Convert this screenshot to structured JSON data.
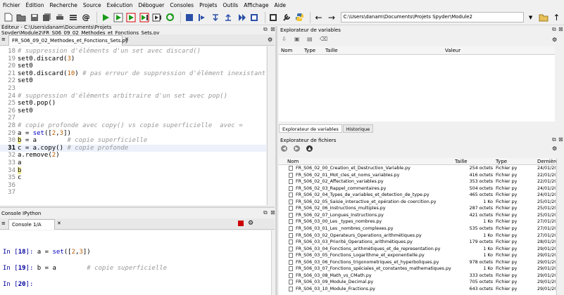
{
  "menubar": [
    "Fichier",
    "Édition",
    "Recherche",
    "Source",
    "Exécution",
    "Déboguer",
    "Consoles",
    "Projets",
    "Outils",
    "Affichage",
    "Aide"
  ],
  "toolbar": {
    "path": "C:\\Users\\danam\\Documents\\Projets Spyder\\Module2"
  },
  "editor": {
    "title": "Éditeur - C:\\Users\\danam\\Documents\\Projets Spyder\\Module2\\FR_S06_09_02_Methodes_et_Fonctions_Sets.py",
    "tab": "FR_S06_09_02_Methodes_et_Fonctions_Sets.py",
    "lines": [
      {
        "n": "18",
        "code": "# suppression d'éléments d'un set avec discard()"
      },
      {
        "n": "19",
        "code": "set0.discard(3)"
      },
      {
        "n": "20",
        "code": "set0"
      },
      {
        "n": "21",
        "code": "set0.discard(10) # pas erreur de suppression d'élément inexistant"
      },
      {
        "n": "22",
        "code": "set0"
      },
      {
        "n": "23",
        "code": ""
      },
      {
        "n": "24",
        "code": "# suppression d'éléments arbitraire d'un set avec pop()"
      },
      {
        "n": "25",
        "code": "set0.pop()"
      },
      {
        "n": "26",
        "code": "set0"
      },
      {
        "n": "27",
        "code": ""
      },
      {
        "n": "28",
        "code": "# copie profonde avec copy() vs copie superficielle  avec ="
      },
      {
        "n": "29",
        "code": "a = set([2,3])"
      },
      {
        "n": "30",
        "code": "b = a        # copie superficielle"
      },
      {
        "n": "31",
        "code": "c = a.copy() # copie profonde"
      },
      {
        "n": "32",
        "code": "a.remove(2)"
      },
      {
        "n": "33",
        "code": "a"
      },
      {
        "n": "34",
        "code": "b"
      },
      {
        "n": "35",
        "code": "c"
      },
      {
        "n": "36",
        "code": ""
      },
      {
        "n": "37",
        "code": ""
      }
    ]
  },
  "variables": {
    "title": "Explorateur de variables",
    "columns": [
      "Nom",
      "Type",
      "Taille",
      "Valeur"
    ],
    "tabs": [
      "Explorateur de variables",
      "Historique"
    ]
  },
  "files": {
    "title": "Explorateur de fichiers",
    "columns": [
      "Nom",
      "Taille",
      "Type",
      "Dernière"
    ],
    "rows": [
      {
        "name": "FR_S06_02_00_Creation_et_Destruction_Variable.py",
        "size": "254 octets",
        "type": "Fichier py",
        "date": "24/01/20"
      },
      {
        "name": "FR_S06_02_01_Mot_cles_et_noms_variables.py",
        "size": "416 octets",
        "type": "Fichier py",
        "date": "22/01/20"
      },
      {
        "name": "FR_S06_02_02_Affectation_variables.py",
        "size": "353 octets",
        "type": "Fichier py",
        "date": "22/01/20"
      },
      {
        "name": "FR_S06_02_03_Rappel_commentaires.py",
        "size": "504 octets",
        "type": "Fichier py",
        "date": "24/01/20"
      },
      {
        "name": "FR_S06_02_04_Types_de_variables_et_detection_de_type.py",
        "size": "465 octets",
        "type": "Fichier py",
        "date": "24/01/20"
      },
      {
        "name": "FR_S06_02_05_Saisie_interactive_et_opération de coercition.py",
        "size": "1 Ko",
        "type": "Fichier py",
        "date": "25/01/20"
      },
      {
        "name": "FR_S06_02_06_Instructions_multiples.py",
        "size": "287 octets",
        "type": "Fichier py",
        "date": "25/01/20"
      },
      {
        "name": "FR_S06_02_07_Longues_Instructions.py",
        "size": "421 octets",
        "type": "Fichier py",
        "date": "25/01/20"
      },
      {
        "name": "FR_S06_03_00_Les _types_nombres.py",
        "size": "1 Ko",
        "type": "Fichier py",
        "date": "27/01/20"
      },
      {
        "name": "FR_S06_03_01_Les _nombres_complexes.py",
        "size": "535 octets",
        "type": "Fichier py",
        "date": "27/01/20"
      },
      {
        "name": "FR_S06_03_02_Operateurs_Operations_arithmétiques.py",
        "size": "1 Ko",
        "type": "Fichier py",
        "date": "27/01/20"
      },
      {
        "name": "FR_S06_03_03_Priorité_Operations_arithmétiques.py",
        "size": "179 octets",
        "type": "Fichier py",
        "date": "28/01/20"
      },
      {
        "name": "FR_S06_03_04_Fonctions_arithmétiques_et_de_representation.py",
        "size": "1 Ko",
        "type": "Fichier py",
        "date": "29/01/20"
      },
      {
        "name": "FR_S06_03_05_Fonctions_Logarithme_et_exponentielle.py",
        "size": "1 Ko",
        "type": "Fichier py",
        "date": "29/01/20"
      },
      {
        "name": "FR_S06_03_06_Fonctions_trigonometriques_et_hyperboliques.py",
        "size": "978 octets",
        "type": "Fichier py",
        "date": "29/01/20"
      },
      {
        "name": "FR_S06_03_07_Fonctions_spéciales_et_constantes_mathematiques.py",
        "size": "1 Ko",
        "type": "Fichier py",
        "date": "29/01/20"
      },
      {
        "name": "FR_S06_03_08_Math_vs_CMath.py",
        "size": "333 octets",
        "type": "Fichier py",
        "date": "29/01/20"
      },
      {
        "name": "FR_S06_03_09_Module_Decimal.py",
        "size": "705 octets",
        "type": "Fichier py",
        "date": "29/01/20"
      },
      {
        "name": "FR_S06_03_10_Module_Fractions.py",
        "size": "643 octets",
        "type": "Fichier py",
        "date": "29/01/20"
      }
    ]
  },
  "console": {
    "title": "Console IPython",
    "tab": "Console 1/A",
    "lines": [
      {
        "prompt": "In [",
        "num": "18",
        "close": "]: ",
        "code": "a = set([2,3])"
      },
      {
        "prompt": "In [",
        "num": "19",
        "close": "]: ",
        "code": "b = a        # copie superficielle"
      },
      {
        "prompt": "In [",
        "num": "20",
        "close": "]: ",
        "code": ""
      }
    ]
  },
  "colors": {
    "accent": "#0000c0",
    "current_line": "#ecf1fb",
    "highlight": "#f5f19a"
  }
}
